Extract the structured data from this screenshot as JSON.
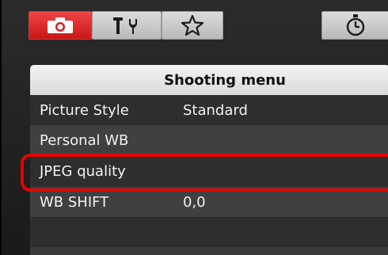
{
  "tabs": [
    {
      "icon": "camera-icon",
      "active": true
    },
    {
      "icon": "wrench-tools-icon",
      "active": false
    },
    {
      "icon": "star-outline-icon",
      "active": false
    },
    {
      "icon": "timer-icon",
      "active": false
    }
  ],
  "menu": {
    "title": "Shooting menu",
    "items": [
      {
        "label": "Picture Style",
        "value": "Standard"
      },
      {
        "label": "Personal WB",
        "value": ""
      },
      {
        "label": "JPEG quality",
        "value": ""
      },
      {
        "label": "WB SHIFT",
        "value": "0,0"
      },
      {
        "label": "",
        "value": ""
      }
    ]
  },
  "colors": {
    "active_tab": "#e02828",
    "highlight": "#e60000",
    "panel": "#2b2b2b"
  }
}
